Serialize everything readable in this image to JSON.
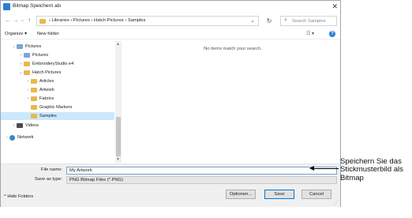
{
  "window": {
    "title": "Bitmap Speichern als",
    "close_glyph": "✕"
  },
  "nav": {
    "back": "←",
    "forward": "→",
    "recent": "⌄",
    "up": "↑",
    "breadcrumb": "›  Libraries  ›  Pictures  ›  Hatch Pictures  ›  Samples",
    "refresh": "↻",
    "search_placeholder": "Search Samples"
  },
  "toolbar": {
    "organize": "Organize ▾",
    "new_folder": "New folder",
    "view": "☷ ▾",
    "help": "?"
  },
  "tree": [
    {
      "label": "Pictures",
      "chev": "⌄",
      "icon": "pics",
      "indent": 1
    },
    {
      "label": "Pictures",
      "chev": "›",
      "icon": "pics",
      "indent": 2
    },
    {
      "label": "EmbroideryStudio e4",
      "chev": "›",
      "icon": "folder",
      "indent": 2
    },
    {
      "label": "Hatch Pictures",
      "chev": "⌄",
      "icon": "folder",
      "indent": 2
    },
    {
      "label": "Articles",
      "chev": "›",
      "icon": "folder",
      "indent": 3
    },
    {
      "label": "Artwork",
      "chev": "›",
      "icon": "folder",
      "indent": 3
    },
    {
      "label": "Fabrics",
      "chev": "›",
      "icon": "folder",
      "indent": 3
    },
    {
      "label": "Graphic Markers",
      "chev": "",
      "icon": "folder",
      "indent": 3
    },
    {
      "label": "Samples",
      "chev": "",
      "icon": "folder",
      "indent": 3,
      "selected": true
    },
    {
      "label": "Videos",
      "chev": "›",
      "icon": "vid",
      "indent": 1
    },
    {
      "label": "Network",
      "chev": "›",
      "icon": "net",
      "indent": 0
    }
  ],
  "content": {
    "empty_message": "No items match your search."
  },
  "form": {
    "file_name_label": "File name:",
    "file_name_value": "My Artwork",
    "save_type_label": "Save as type:",
    "save_type_value": "PNG Bitmap Files (*.PNG)"
  },
  "footer": {
    "hide_folders": "^ Hide Folders",
    "options": "Optionen...",
    "save": "Save",
    "cancel": "Cancel"
  },
  "callout": {
    "text": "Speichern Sie das Stickmusterbild als Bitmap"
  }
}
